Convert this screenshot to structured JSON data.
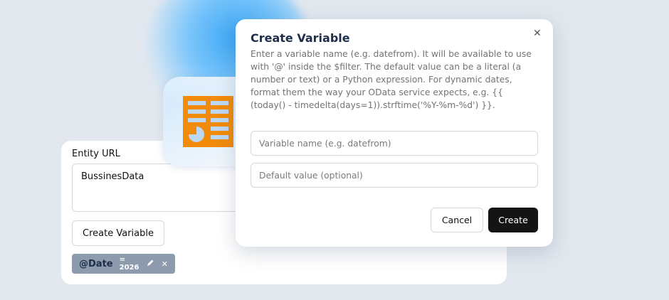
{
  "panel": {
    "entity_label": "Entity URL",
    "entity_value": "BussinesData",
    "create_variable_label": "Create Variable",
    "variable_chip": {
      "name": "@Date",
      "value": "= 2026",
      "edit_icon": "pencil-icon",
      "remove_icon": "close-icon"
    }
  },
  "modal": {
    "title": "Create Variable",
    "close_icon": "close-icon",
    "description": "Enter a variable name (e.g. datefrom). It will be available to use with '@' inside the $filter. The default value can be a literal (a number or text) or a Python expression. For dynamic dates, format them the way your OData service expects, e.g. {{ (today() - timedelta(days=1)).strftime('%Y-%m-%d') }}.",
    "name_placeholder": "Variable name (e.g. datefrom)",
    "name_value": "",
    "default_placeholder": "Default value (optional)",
    "default_value": "",
    "cancel_label": "Cancel",
    "create_label": "Create"
  },
  "app_icon": "report-document-icon",
  "colors": {
    "background": "#e3e8ef",
    "accent_orange": "#f28a0a",
    "chip_bg": "#8e9bae",
    "primary_button": "#141414"
  }
}
